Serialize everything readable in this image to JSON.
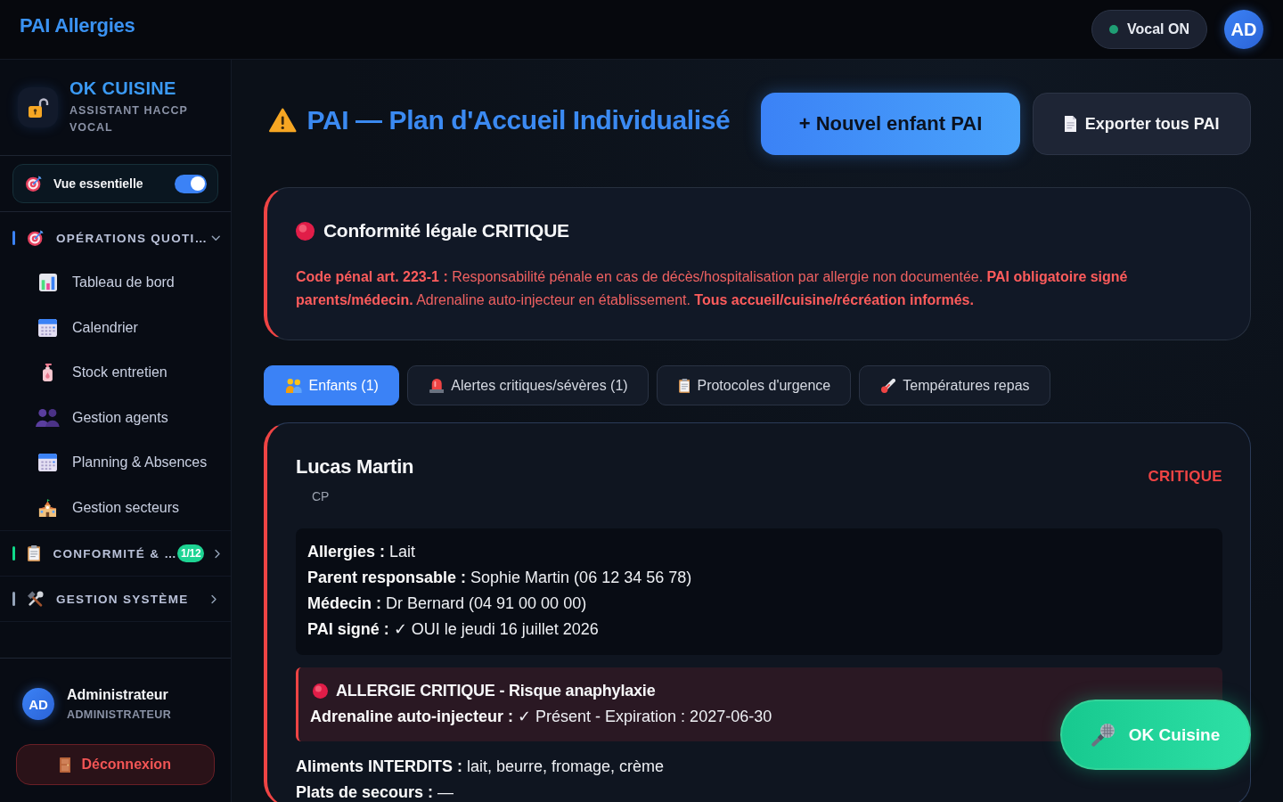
{
  "app_bar": {
    "title": "PAI Allergies",
    "voice_status": {
      "label": "Vocal ON",
      "on": true
    },
    "avatar": {
      "initials": "AD"
    }
  },
  "sidebar": {
    "brand": {
      "title": "OK CUISINE",
      "subtitle": "ASSISTANT HACCP VOCAL"
    },
    "view_toggle": {
      "label": "Vue essentielle",
      "on": true
    },
    "sections": [
      {
        "label": "OPÉRATIONS QUOTI…",
        "color": "#3b82f6",
        "expanded": true,
        "items": [
          {
            "label": "Tableau de bord",
            "selected": false
          },
          {
            "label": "Calendrier",
            "selected": false
          },
          {
            "label": "Stock entretien",
            "selected": false
          },
          {
            "label": "Gestion agents",
            "selected": false
          },
          {
            "label": "Planning & Absences",
            "selected": false
          },
          {
            "label": "Gestion secteurs",
            "selected": false
          }
        ]
      },
      {
        "label": "CONFORMITÉ & …",
        "color": "#10d98a",
        "expanded": false,
        "badge": "1/12"
      },
      {
        "label": "GESTION SYSTÈME",
        "color": "#94a3b8",
        "expanded": false
      }
    ],
    "user": {
      "initials": "AD",
      "name": "Administrateur",
      "role": "ADMINISTRATEUR"
    },
    "logout": {
      "label": "Déconnexion"
    }
  },
  "page_header": {
    "title": "PAI — Plan d'Accueil Individualisé",
    "actions": [
      {
        "label": "+ Nouvel enfant PAI",
        "kind": "primary"
      },
      {
        "label": "Exporter tous PAI",
        "kind": "secondary"
      }
    ]
  },
  "legal_alert": {
    "title": "Conformité légale CRITIQUE",
    "text": "**Code pénal art. 223-1 :** Responsabilité pénale en cas de décès/hospitalisation par allergie non documentée. **PAI obligatoire signé parents/médecin.** Adrenaline auto-injecteur en établissement. **Tous accueil/cuisine/récréation informés.**"
  },
  "tabs": [
    {
      "label": "Enfants (1)",
      "selected": true
    },
    {
      "label": "Alertes critiques/sévères (1)",
      "selected": false
    },
    {
      "label": "Protocoles d'urgence",
      "selected": false
    },
    {
      "label": "Températures repas",
      "selected": false
    }
  ],
  "children": [
    {
      "name": "Lucas Martin",
      "grade": "CP",
      "severity": {
        "label": "CRITIQUE",
        "kind": "critical"
      },
      "details": [
        {
          "label": "Allergies :",
          "value": "Lait"
        },
        {
          "label": "Parent responsable :",
          "value": "Sophie Martin (06 12 34 56 78)"
        },
        {
          "label": "Médecin :",
          "value": "Dr Bernard (04 91 00 00 00)"
        },
        {
          "label": "PAI signé :",
          "value": "✓ OUI le jeudi 16 juillet 2026"
        }
      ],
      "critical_allergy": {
        "title": "ALLERGIE CRITIQUE - Risque anaphylaxie",
        "details": [
          {
            "label": "Adrenaline auto-injecteur :",
            "value": "✓ Présent - Expiration : 2027-06-30"
          }
        ]
      },
      "notes": [
        {
          "label": "Aliments INTERDITS :",
          "value": "lait, beurre, fromage, crème"
        },
        {
          "label": "Plats de secours :",
          "value": "—"
        }
      ]
    }
  ],
  "voice_button": {
    "label": "OK Cuisine"
  }
}
